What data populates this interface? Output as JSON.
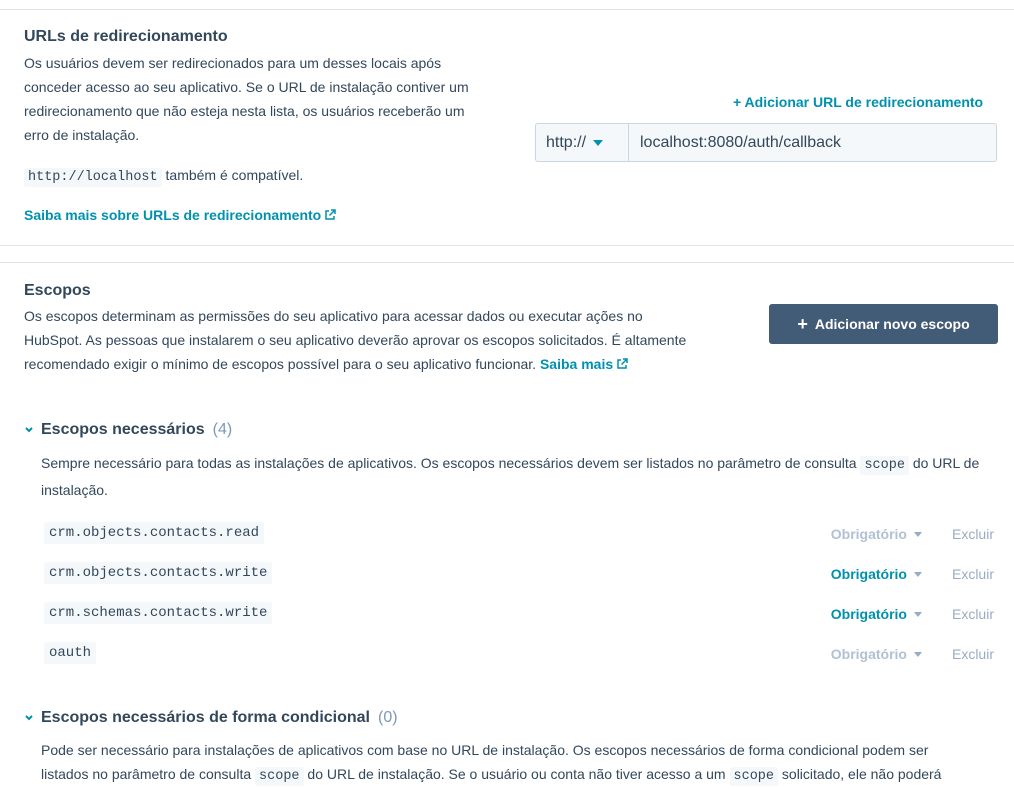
{
  "redirect": {
    "title": "URLs de redirecionamento",
    "description": "Os usuários devem ser redirecionados para um desses locais após conceder acesso ao seu aplicativo. Se o URL de instalação contiver um redirecionamento que não esteja nesta lista, os usuários receberão um erro de instalação.",
    "localhost_code": "http://localhost",
    "localhost_note": "também é compatível.",
    "learn_more": "Saiba mais sobre URLs de redirecionamento",
    "add_link": "+ Adicionar URL de redirecionamento",
    "protocol": "http://",
    "url_value": "localhost:8080/auth/callback"
  },
  "scopes": {
    "title": "Escopos",
    "description": "Os escopos determinam as permissões do seu aplicativo para acessar dados ou executar ações no HubSpot. As pessoas que instalarem o seu aplicativo deverão aprovar os escopos solicitados. É altamente recomendado exigir o mínimo de escopos possível para o seu aplicativo funcionar.",
    "learn_more": "Saiba mais",
    "add_button": "Adicionar novo escopo",
    "required": {
      "title": "Escopos necessários",
      "count": "(4)",
      "desc_pre": "Sempre necessário para todas as instalações de aplicativos. Os escopos necessários devem ser listados no parâmetro de consulta",
      "desc_code": "scope",
      "desc_post": "do URL de instalação.",
      "items": [
        {
          "name": "crm.objects.contacts.read",
          "requirement": "Obrigatório",
          "delete": "Excluir"
        },
        {
          "name": "crm.objects.contacts.write",
          "requirement": "Obrigatório",
          "delete": "Excluir"
        },
        {
          "name": "crm.schemas.contacts.write",
          "requirement": "Obrigatório",
          "delete": "Excluir"
        },
        {
          "name": "oauth",
          "requirement": "Obrigatório",
          "delete": "Excluir"
        }
      ]
    },
    "conditional": {
      "title": "Escopos necessários de forma condicional",
      "count": "(0)",
      "desc_1": "Pode ser necessário para instalações de aplicativos com base no URL de instalação. Os escopos necessários de forma condicional podem ser",
      "desc_2a": "listados no parâmetro de consulta",
      "desc_code_1": "scope",
      "desc_2b": "do URL de instalação. Se o usuário ou conta não tiver acesso a um",
      "desc_code_2": "scope",
      "desc_2c": "solicitado, ele não poderá"
    }
  },
  "colors": {
    "text": "#33475b",
    "link": "#0091ae",
    "button": "#425b76",
    "muted": "#b0c1d4",
    "divider": "#dfe3eb"
  }
}
